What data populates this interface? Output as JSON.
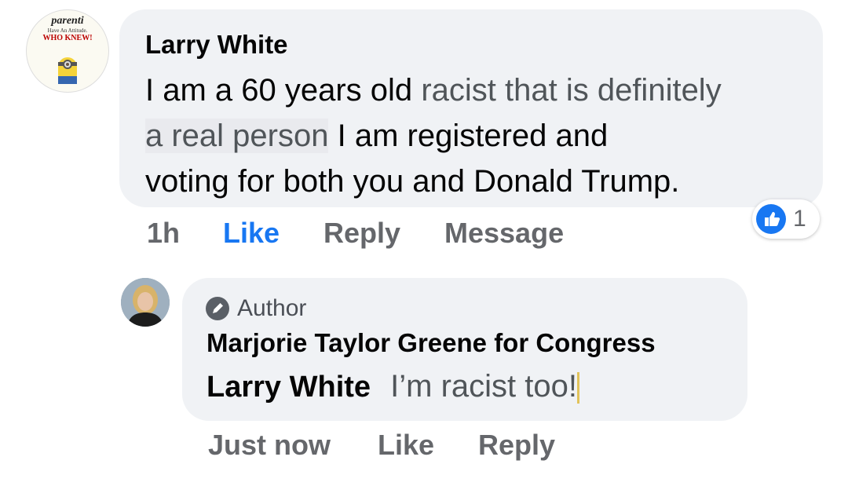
{
  "comment": {
    "avatar": {
      "line1": "parenti",
      "line2": "Have An Attitude.",
      "line3": "WHO KNEW!"
    },
    "author": "Larry White",
    "text_part1": "I am a 60 years old",
    "text_edit1": "racist that is definitely",
    "text_edit2": "a real person",
    "text_part2": "I am registered and",
    "text_part3": "voting for both you and Donald Trump.",
    "time": "1h",
    "like_label": "Like",
    "reply_label": "Reply",
    "message_label": "Message",
    "reaction_count": "1",
    "colors": {
      "like_active": "#1877f2",
      "bubble": "#f0f2f5",
      "action_gray": "#65676b"
    }
  },
  "reply": {
    "badge_label": "Author",
    "author": "Marjorie Taylor Greene for Congress",
    "mention": "Larry White",
    "text": "I’m racist too!",
    "time": "Just now",
    "like_label": "Like",
    "reply_label": "Reply"
  }
}
